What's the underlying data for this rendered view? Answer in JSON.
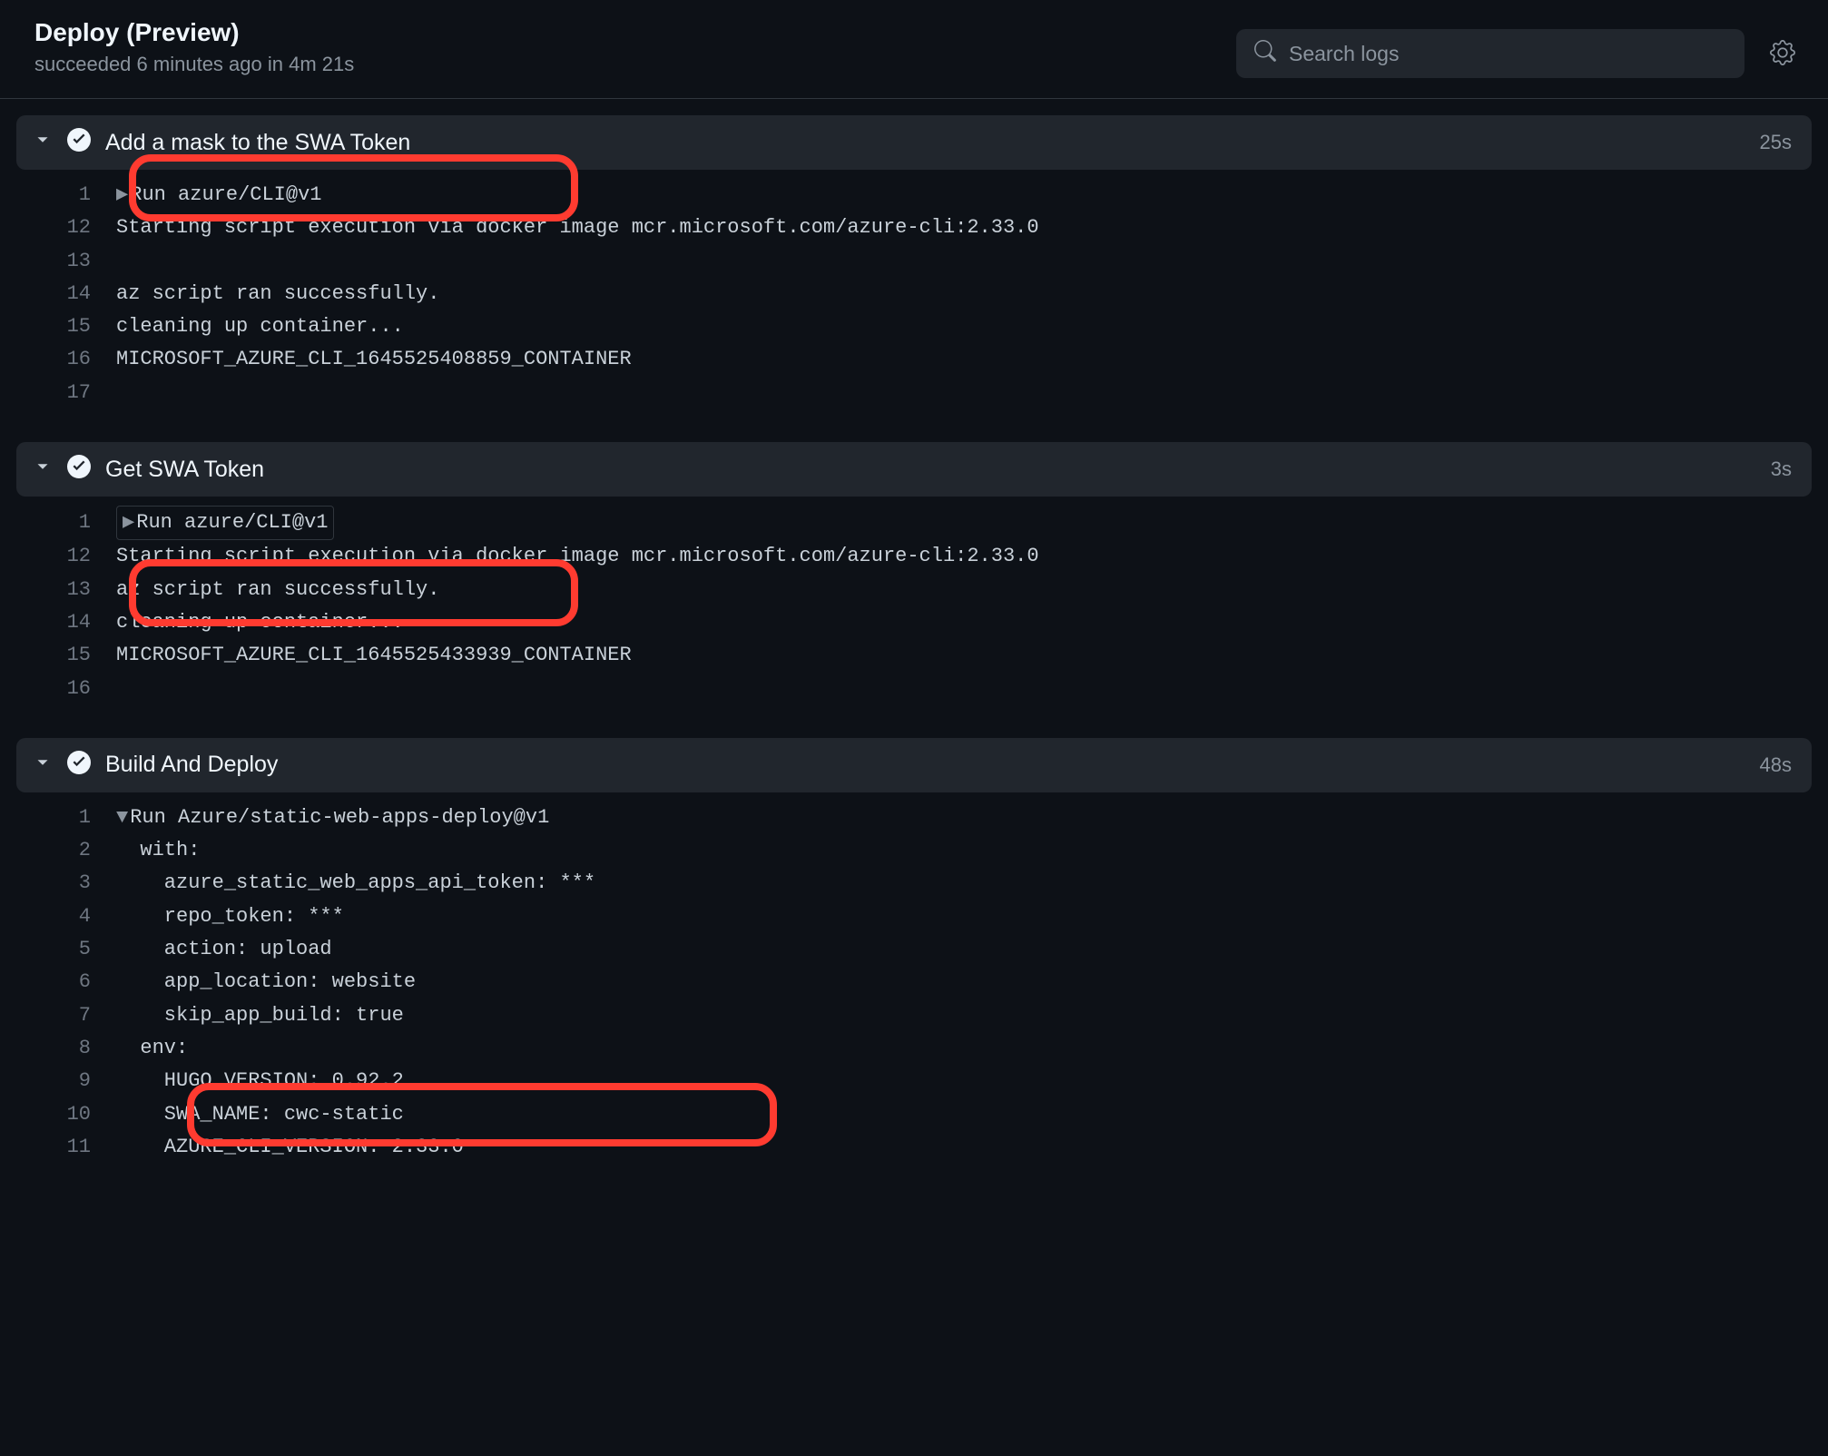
{
  "header": {
    "title": "Deploy (Preview)",
    "status": "succeeded",
    "time_ago": "6 minutes ago",
    "in_word": "in",
    "duration": "4m 21s"
  },
  "search": {
    "placeholder": "Search logs"
  },
  "steps": [
    {
      "title": "Add a mask to the SWA Token",
      "duration": "25s",
      "lines": [
        {
          "n": "1",
          "caret": "right",
          "text": "Run azure/CLI@v1"
        },
        {
          "n": "12",
          "text": "Starting script execution via docker image mcr.microsoft.com/azure-cli:2.33.0"
        },
        {
          "n": "13",
          "text": ""
        },
        {
          "n": "14",
          "text": "az script ran successfully."
        },
        {
          "n": "15",
          "text": "cleaning up container..."
        },
        {
          "n": "16",
          "text": "MICROSOFT_AZURE_CLI_1645525408859_CONTAINER"
        },
        {
          "n": "17",
          "text": ""
        }
      ]
    },
    {
      "title": "Get SWA Token",
      "duration": "3s",
      "lines": [
        {
          "n": "1",
          "caret": "right",
          "boxed": true,
          "text": "Run azure/CLI@v1"
        },
        {
          "n": "12",
          "text": "Starting script execution via docker image mcr.microsoft.com/azure-cli:2.33.0"
        },
        {
          "n": "13",
          "text": "az script ran successfully."
        },
        {
          "n": "14",
          "text": "cleaning up container..."
        },
        {
          "n": "15",
          "text": "MICROSOFT_AZURE_CLI_1645525433939_CONTAINER"
        },
        {
          "n": "16",
          "text": ""
        }
      ]
    },
    {
      "title": "Build And Deploy",
      "duration": "48s",
      "lines": [
        {
          "n": "1",
          "caret": "down",
          "text": "Run Azure/static-web-apps-deploy@v1"
        },
        {
          "n": "2",
          "text": "  with:"
        },
        {
          "n": "3",
          "text": "    azure_static_web_apps_api_token: ***"
        },
        {
          "n": "4",
          "text": "    repo_token: ***"
        },
        {
          "n": "5",
          "text": "    action: upload"
        },
        {
          "n": "6",
          "text": "    app_location: website"
        },
        {
          "n": "7",
          "text": "    skip_app_build: true"
        },
        {
          "n": "8",
          "text": "  env:"
        },
        {
          "n": "9",
          "text": "    HUGO_VERSION: 0.92.2"
        },
        {
          "n": "10",
          "text": "    SWA_NAME: cwc-static"
        },
        {
          "n": "11",
          "text": "    AZURE_CLI_VERSION: 2.33.0"
        }
      ]
    }
  ]
}
